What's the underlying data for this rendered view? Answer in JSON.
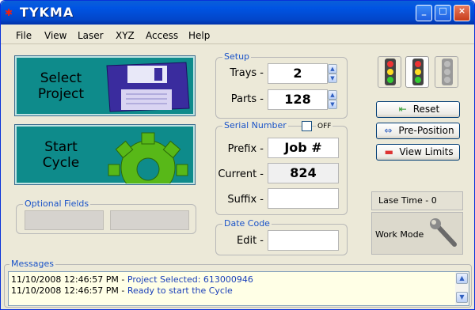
{
  "window": {
    "title": "TYKMA",
    "logo": "✱"
  },
  "menu": [
    "File",
    "View",
    "Laser",
    "XYZ",
    "Access",
    "Help"
  ],
  "buttons": {
    "select_project": "Select\nProject",
    "start_cycle": "Start\nCycle"
  },
  "optional_fields": {
    "title": "Optional Fields"
  },
  "setup": {
    "title": "Setup",
    "trays_label": "Trays -",
    "trays_value": "2",
    "parts_label": "Parts -",
    "parts_value": "128"
  },
  "serial": {
    "title": "Serial Number",
    "toggle_label": "OFF",
    "prefix_label": "Prefix -",
    "prefix_value": "Job #",
    "current_label": "Current -",
    "current_value": "824",
    "suffix_label": "Suffix -",
    "suffix_value": ""
  },
  "datecode": {
    "title": "Date Code",
    "edit_label": "Edit -",
    "edit_value": ""
  },
  "side": {
    "reset": "Reset",
    "preposition": "Pre-Position",
    "view_limits": "View Limits",
    "lase_time": "Lase Time - 0",
    "work_mode": "Work Mode"
  },
  "messages": {
    "title": "Messages",
    "lines": [
      {
        "time": "11/10/2008 12:46:57 PM -",
        "text": "Project Selected:  613000946"
      },
      {
        "time": "11/10/2008 12:46:57 PM -",
        "text": "Ready to start the Cycle"
      }
    ]
  },
  "colors": {
    "teal": "#0e8b8b",
    "accent_blue": "#1a53c8",
    "title_blue": "#0054e3"
  },
  "icons": [
    "floppy-disk-icon",
    "gear-icon",
    "traffic-light-icon",
    "wrench-icon"
  ]
}
